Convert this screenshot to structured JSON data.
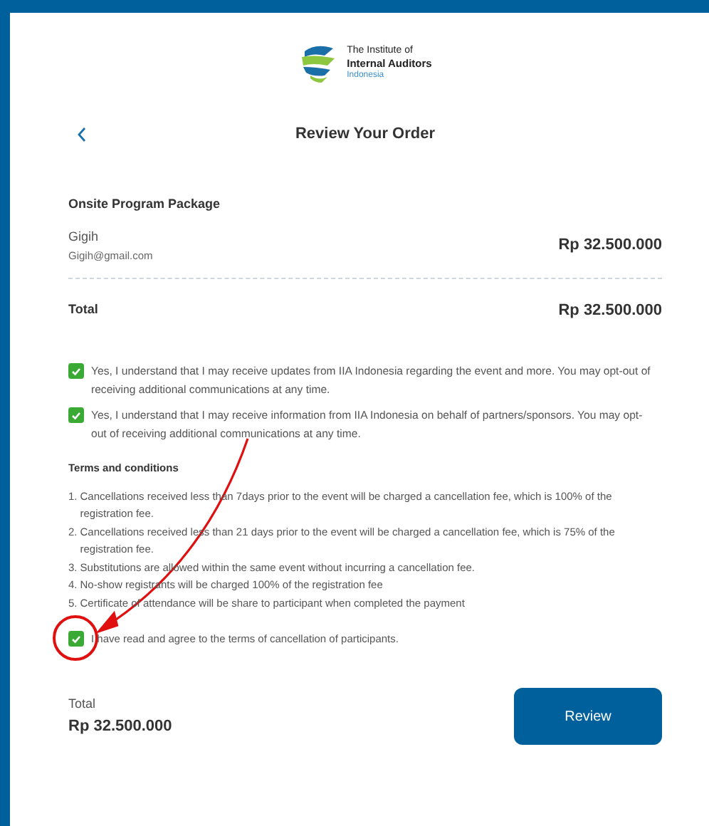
{
  "logo": {
    "line_1": "The Institute of",
    "line_2": "Internal Auditors",
    "line_3": "Indonesia"
  },
  "header": {
    "title": "Review Your Order"
  },
  "package": {
    "title": "Onsite Program Package",
    "name": "Gigih",
    "email": "Gigih@gmail.com",
    "price": "Rp 32.500.000"
  },
  "total": {
    "label": "Total",
    "value": "Rp 32.500.000"
  },
  "consents": [
    {
      "text": "Yes, I understand that I may receive updates from IIA Indonesia regarding the event and more. You may opt-out of receiving additional communications at any time.",
      "checked": true
    },
    {
      "text": "Yes, I understand that I may receive information from IIA Indonesia on behalf of partners/sponsors. You may opt-out of receiving additional communications at any time.",
      "checked": true
    }
  ],
  "terms": {
    "title": "Terms and conditions",
    "items": [
      {
        "number": "1.",
        "text": "Cancellations received less than 7days prior to the event will be charged a cancellation fee, which is 100% of the registration fee."
      },
      {
        "number": "2.",
        "text": "Cancellations received less than 21 days prior to the event will be charged a cancellation fee, which is 75% of the registration fee."
      },
      {
        "number": "3.",
        "text": "Substitutions are allowed within the same event without incurring a cancellation fee."
      },
      {
        "number": "4.",
        "text": "No-show registrants will be charged 100% of the registration fee"
      },
      {
        "number": "5.",
        "text": "Certificate of attendance will be share to participant when completed the payment"
      }
    ]
  },
  "agreement": {
    "text": "I have read and agree to the terms of cancellation of participants.",
    "checked": true
  },
  "footer": {
    "label": "Total",
    "value": "Rp 32.500.000",
    "button": "Review"
  }
}
